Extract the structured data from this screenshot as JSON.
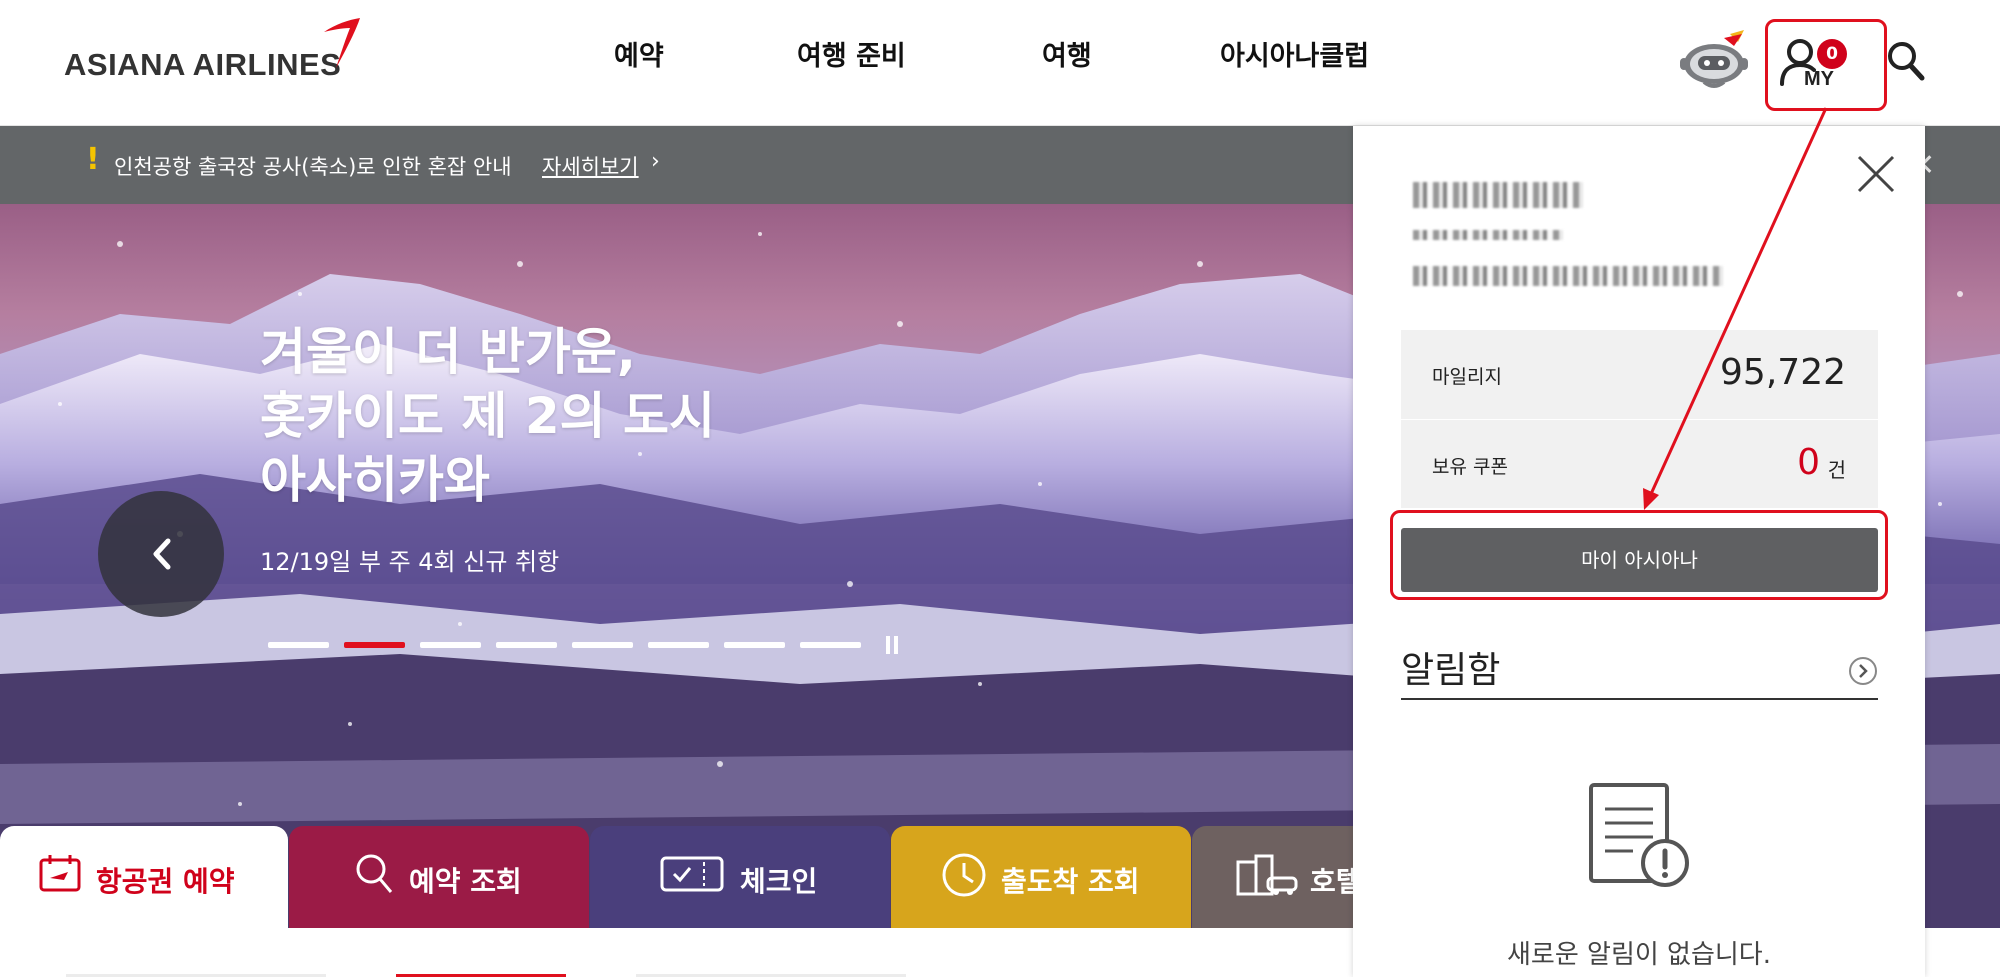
{
  "brand": {
    "name": "ASIANA AIRLINES",
    "accent": "#e0101e"
  },
  "nav": {
    "items": [
      "예약",
      "여행 준비",
      "여행",
      "아시아나클럽"
    ]
  },
  "header_icons": {
    "chatbot": "robot-icon",
    "my_badge": "0",
    "my_label": "MY",
    "search": "search-icon"
  },
  "notice": {
    "mark": "!",
    "text": "인천공항 출국장 공사(축소)로 인한 혼잡 안내",
    "link": "자세히보기",
    "arrow": "›",
    "close": "✕"
  },
  "hero": {
    "title": "겨울이 더 반가운,\n홋카이도 제 2의 도시\n아사히카와",
    "subtitle": "12/19일 부 주 4회 신규 취항",
    "slide_count": 8,
    "active_slide": 2
  },
  "tabs": [
    {
      "label": "항공권 예약",
      "icon": "ticket-icon",
      "color": "#ffffff",
      "text_color": "#d0021b"
    },
    {
      "label": "예약 조회",
      "icon": "search-icon",
      "color": "#9b1b46",
      "text_color": "#ffffff"
    },
    {
      "label": "체크인",
      "icon": "checkin-ticket-icon",
      "color": "#4a3f7c",
      "text_color": "#ffffff"
    },
    {
      "label": "출도착 조회",
      "icon": "clock-icon",
      "color": "#d7a51c",
      "text_color": "#ffffff"
    },
    {
      "label": "호텔",
      "icon": "hotel-car-icon",
      "color": "#6e6160",
      "text_color": "#ffffff"
    }
  ],
  "my_popup": {
    "close": "close-icon",
    "mileage_label": "마일리지",
    "mileage_value": "95,722",
    "coupon_label": "보유 쿠폰",
    "coupon_value": "0",
    "coupon_unit": "건",
    "my_asiana_button": "마이 아시아나",
    "inbox_title": "알림함",
    "empty_message": "새로운 알림이 없습니다."
  }
}
